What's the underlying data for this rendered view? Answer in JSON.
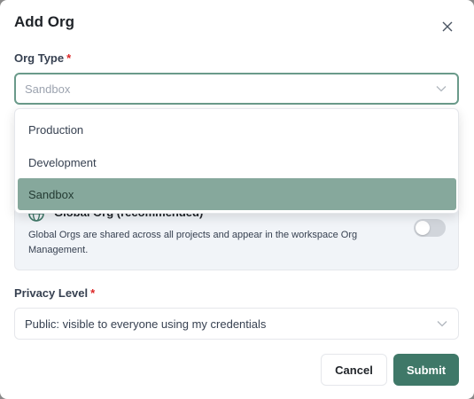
{
  "dialog": {
    "title": "Add Org"
  },
  "org_type": {
    "label": "Org Type",
    "required_mark": "*",
    "selected_value": "Sandbox",
    "options": [
      {
        "label": "Production",
        "selected": false
      },
      {
        "label": "Development",
        "selected": false
      },
      {
        "label": "Sandbox",
        "selected": true
      }
    ]
  },
  "global_org": {
    "title": "Global Org (recommended)",
    "description": "Global Orgs are shared across all projects and appear in the workspace Org Management.",
    "toggle_on": false,
    "icon": "globe-icon"
  },
  "privacy": {
    "label": "Privacy Level",
    "required_mark": "*",
    "selected_value": "Public: visible to everyone using my credentials"
  },
  "actions": {
    "cancel_label": "Cancel",
    "submit_label": "Submit"
  },
  "colors": {
    "accent": "#3f7868",
    "selected_option_bg": "#86a89c",
    "required": "#dc2626"
  }
}
